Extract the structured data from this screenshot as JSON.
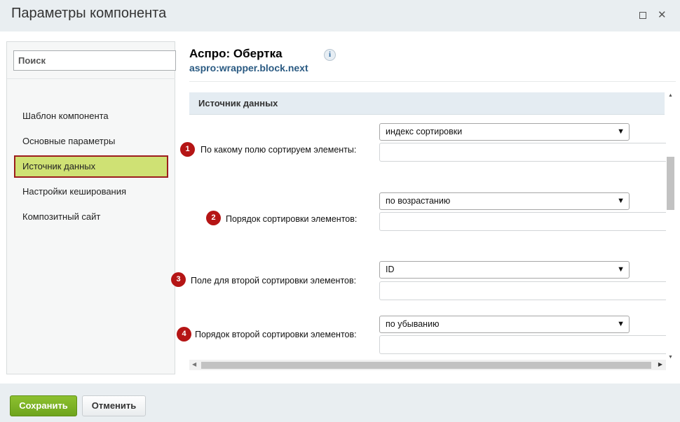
{
  "window": {
    "title": "Параметры компонента",
    "maximize_icon": "maximize-icon",
    "close_icon": "close-icon"
  },
  "sidebar": {
    "search_placeholder": "Поиск",
    "items": [
      {
        "label": "Шаблон компонента",
        "active": false
      },
      {
        "label": "Основные параметры",
        "active": false
      },
      {
        "label": "Источник данных",
        "active": true
      },
      {
        "label": "Настройки кеширования",
        "active": false
      },
      {
        "label": "Композитный сайт",
        "active": false
      }
    ]
  },
  "component": {
    "name": "Аспро: Обертка",
    "code": "aspro:wrapper.block.next",
    "info_icon": "i"
  },
  "section": {
    "title": "Источник данных"
  },
  "params": [
    {
      "badge": "1",
      "label": "По какому полю сортируем элементы:",
      "selected": "индекс сортировки",
      "text_value": ""
    },
    {
      "badge": "2",
      "label": "Порядок сортировки элементов:",
      "selected": "по возрастанию",
      "text_value": ""
    },
    {
      "badge": "3",
      "label": "Поле для второй сортировки элементов:",
      "selected": "ID",
      "text_value": ""
    },
    {
      "badge": "4",
      "label": "Порядок второй сортировки элементов:",
      "selected": "по убыванию",
      "text_value": ""
    }
  ],
  "footer": {
    "save_label": "Сохранить",
    "cancel_label": "Отменить"
  },
  "colors": {
    "active_item_bg": "#cfe174",
    "active_item_border": "#9c1d1d",
    "badge": "#b51515",
    "save_button": "#7ab125",
    "section_bar": "#e4ecf2"
  }
}
